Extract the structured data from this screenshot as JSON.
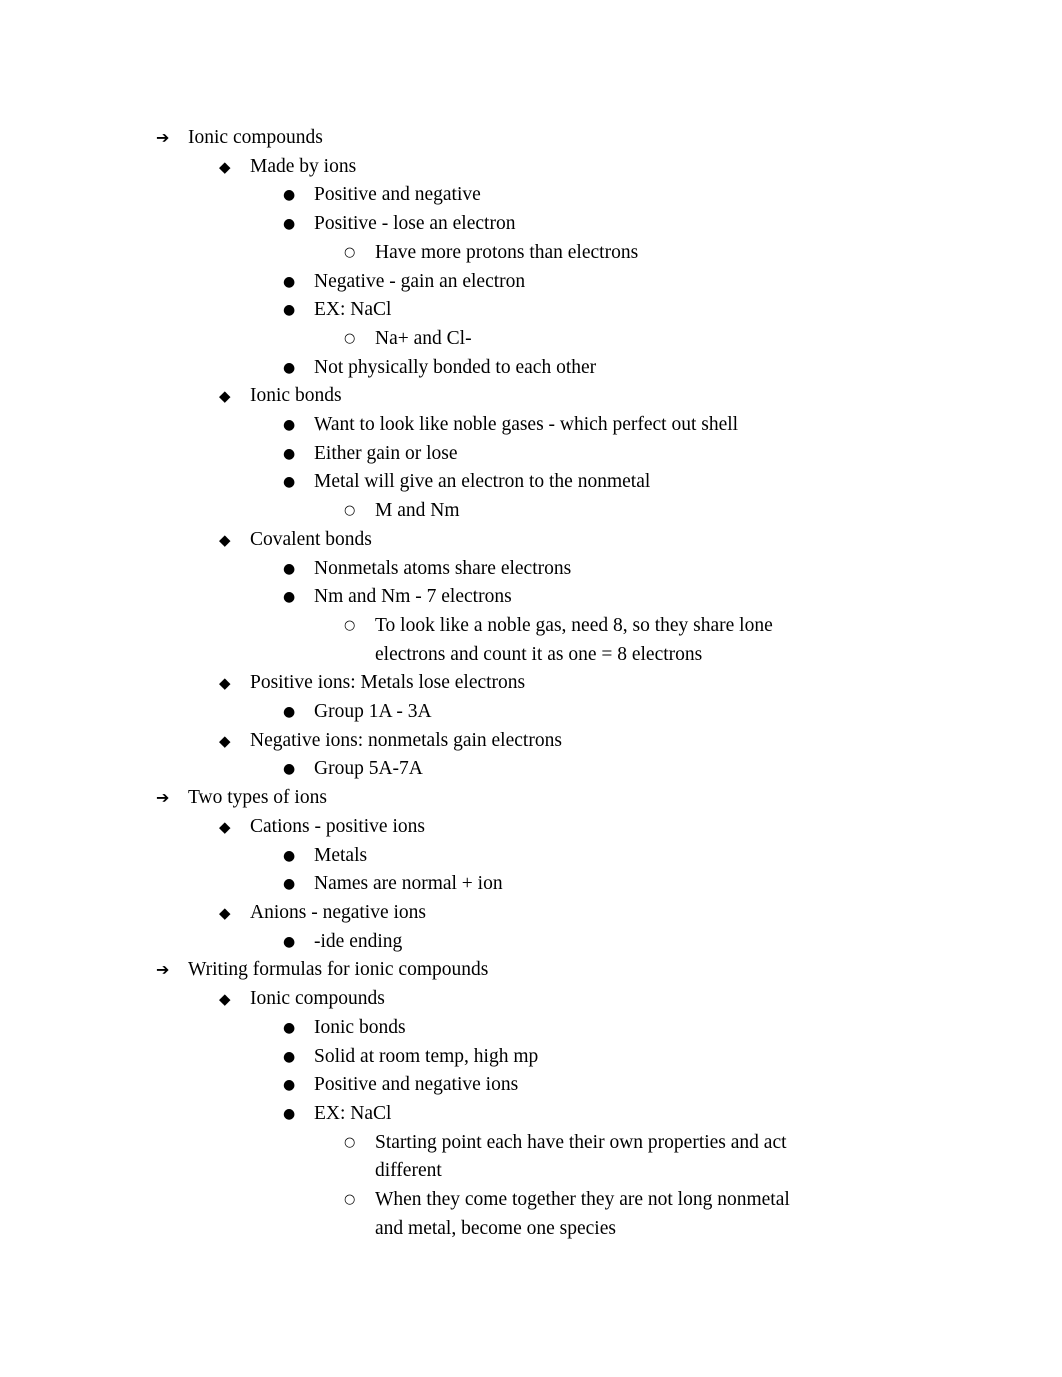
{
  "document": {
    "title": "Ionic Compounds Notes",
    "background_color": "#ffffff",
    "text_color": "#000000",
    "bullet_glyphs": {
      "level1": "➔",
      "level2": "◆",
      "level3": "●",
      "level4": "○"
    }
  },
  "outline": [
    {
      "level": 1,
      "text": "Ionic compounds"
    },
    {
      "level": 2,
      "text": "Made by ions"
    },
    {
      "level": 3,
      "text": "Positive and negative"
    },
    {
      "level": 3,
      "text": "Positive - lose an electron"
    },
    {
      "level": 4,
      "text": "Have more protons than electrons"
    },
    {
      "level": 3,
      "text": "Negative - gain an electron"
    },
    {
      "level": 3,
      "text": "EX: NaCl"
    },
    {
      "level": 4,
      "text": "Na+ and Cl-"
    },
    {
      "level": 3,
      "text": "Not physically bonded to each other"
    },
    {
      "level": 2,
      "text": "Ionic bonds"
    },
    {
      "level": 3,
      "text": "Want to look like noble gases - which perfect out shell"
    },
    {
      "level": 3,
      "text": "Either gain or lose"
    },
    {
      "level": 3,
      "text": "Metal will give an electron to the nonmetal"
    },
    {
      "level": 4,
      "text": "M and Nm"
    },
    {
      "level": 2,
      "text": "Covalent bonds"
    },
    {
      "level": 3,
      "text": "Nonmetals atoms share electrons"
    },
    {
      "level": 3,
      "text": "Nm and Nm - 7 electrons"
    },
    {
      "level": 4,
      "text": "To look like a noble gas, need 8, so they share lone electrons and count it as one = 8 electrons"
    },
    {
      "level": 2,
      "text": "Positive ions: Metals lose electrons"
    },
    {
      "level": 3,
      "text": "Group 1A - 3A"
    },
    {
      "level": 2,
      "text": "Negative ions: nonmetals gain electrons"
    },
    {
      "level": 3,
      "text": "Group 5A-7A"
    },
    {
      "level": 1,
      "text": "Two types of ions"
    },
    {
      "level": 2,
      "text": "Cations - positive ions"
    },
    {
      "level": 3,
      "text": "Metals"
    },
    {
      "level": 3,
      "text": "Names are normal + ion"
    },
    {
      "level": 2,
      "text": "Anions - negative ions"
    },
    {
      "level": 3,
      "text": "-ide ending"
    },
    {
      "level": 1,
      "text": "Writing formulas for ionic compounds"
    },
    {
      "level": 2,
      "text": "Ionic compounds"
    },
    {
      "level": 3,
      "text": "Ionic bonds"
    },
    {
      "level": 3,
      "text": "Solid at room temp, high mp"
    },
    {
      "level": 3,
      "text": "Positive and negative ions"
    },
    {
      "level": 3,
      "text": "EX: NaCl"
    },
    {
      "level": 4,
      "text": "Starting point each have their own properties and act different"
    },
    {
      "level": 4,
      "text": "When they come together they are not long nonmetal and metal, become one species"
    }
  ]
}
